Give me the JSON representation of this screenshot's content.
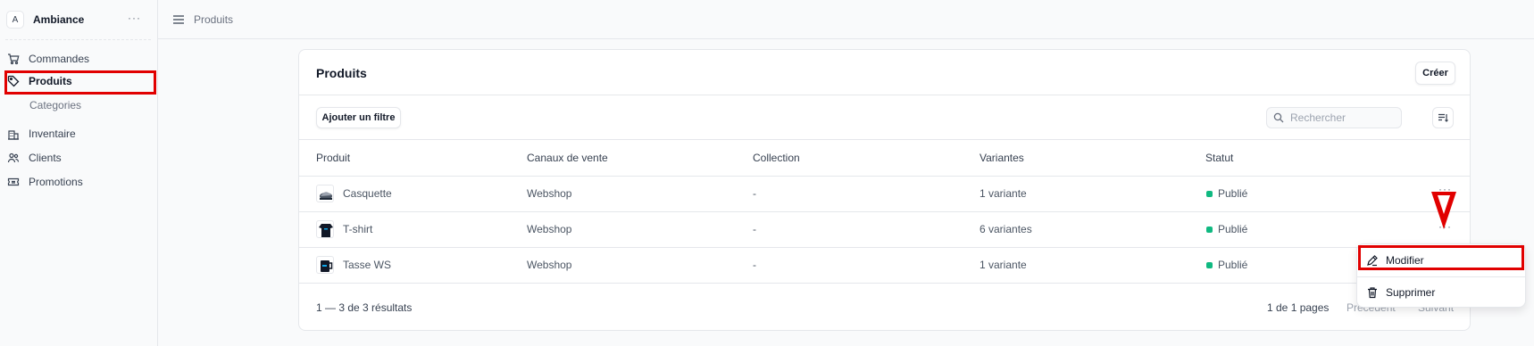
{
  "sidebar": {
    "store": {
      "avatar": "A",
      "name": "Ambiance",
      "more": "···"
    },
    "items": [
      {
        "label": "Commandes",
        "icon": "cart-icon"
      },
      {
        "label": "Produits",
        "icon": "tag-icon"
      },
      {
        "label": "Categories"
      },
      {
        "label": "Inventaire",
        "icon": "building-icon"
      },
      {
        "label": "Clients",
        "icon": "users-icon"
      },
      {
        "label": "Promotions",
        "icon": "ticket-icon"
      }
    ]
  },
  "topbar": {
    "breadcrumb": "Produits",
    "icon": "menu-icon"
  },
  "products": {
    "title": "Produits",
    "create_label": "Créer",
    "filter_label": "Ajouter un filtre",
    "search_placeholder": "Rechercher",
    "columns": [
      "Produit",
      "Canaux de vente",
      "Collection",
      "Variantes",
      "Statut"
    ],
    "rows": [
      {
        "name": "Casquette",
        "channel": "Webshop",
        "collection": "-",
        "variants": "1 variante",
        "status": "Publié"
      },
      {
        "name": "T-shirt",
        "channel": "Webshop",
        "collection": "-",
        "variants": "6 variantes",
        "status": "Publié"
      },
      {
        "name": "Tasse WS",
        "channel": "Webshop",
        "collection": "-",
        "variants": "1 variante",
        "status": "Publié"
      }
    ],
    "more": "···",
    "results_text": "1 — 3 de 3 résultats",
    "pages_text": "1 de 1 pages",
    "prev_label": "Précédent",
    "next_label": "Suivant"
  },
  "menu": {
    "edit_label": "Modifier",
    "delete_label": "Supprimer"
  },
  "colors": {
    "accent_highlight": "#e10000",
    "status_published": "#10b981"
  }
}
